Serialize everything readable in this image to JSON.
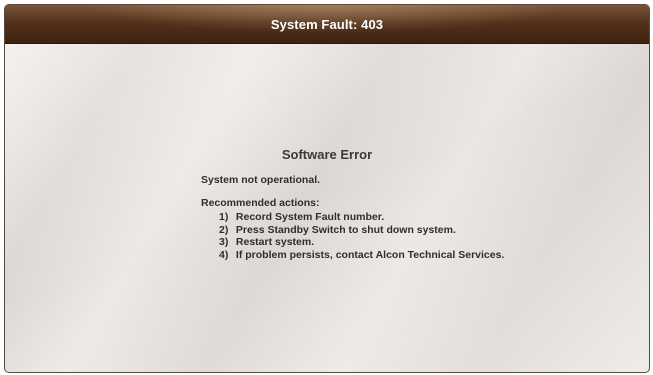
{
  "dialog": {
    "title": "System Fault: 403",
    "heading": "Software Error",
    "status": "System not operational.",
    "recommended_heading": "Recommended actions:",
    "actions": [
      {
        "num": "1)",
        "text": "Record System Fault number."
      },
      {
        "num": "2)",
        "text": "Press Standby Switch to shut down system."
      },
      {
        "num": "3)",
        "text": "Restart system."
      },
      {
        "num": "4)",
        "text": "If problem persists, contact Alcon Technical Services."
      }
    ]
  },
  "colors": {
    "title_bar": "#54321c",
    "title_text": "#ffffff",
    "body_text": "#2e2e2e",
    "background": "#e4dfdc"
  }
}
